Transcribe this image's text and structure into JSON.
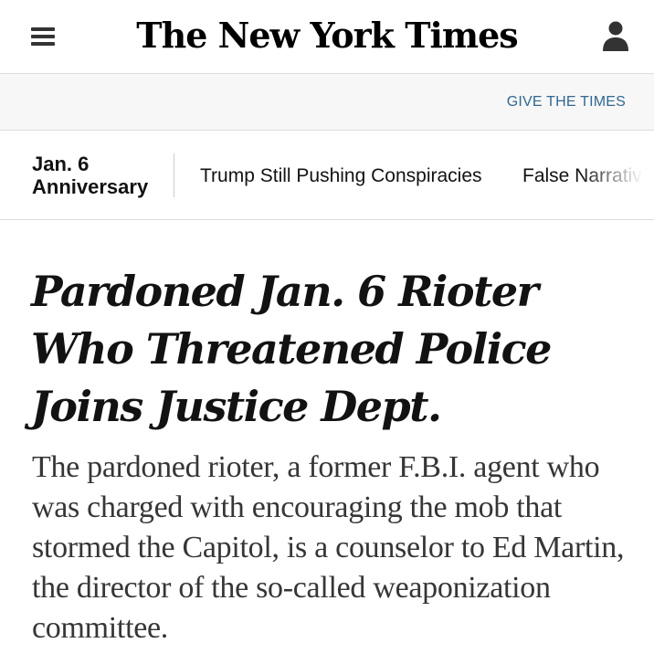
{
  "header": {
    "logo_text": "The New York Times",
    "menu_icon": "hamburger-menu-icon",
    "account_icon": "user-account-icon"
  },
  "promo": {
    "link_text": "GIVE THE TIMES"
  },
  "subnav": {
    "label_line1": "Jan. 6",
    "label_line2": "Anniversary",
    "links": [
      "Trump Still Pushing Conspiracies",
      "False Narrative"
    ]
  },
  "article": {
    "headline": "Pardoned Jan. 6 Rioter Who Threatened Police Joins Justice Dept.",
    "summary": "The pardoned rioter, a former F.B.I. agent who was charged with encouraging the mob that stormed the Capitol, is a counselor to Ed Martin, the director of the so-called weaponization committee."
  },
  "colors": {
    "link_blue": "#326891",
    "promo_bg": "#f7f7f7",
    "text": "#121212"
  }
}
